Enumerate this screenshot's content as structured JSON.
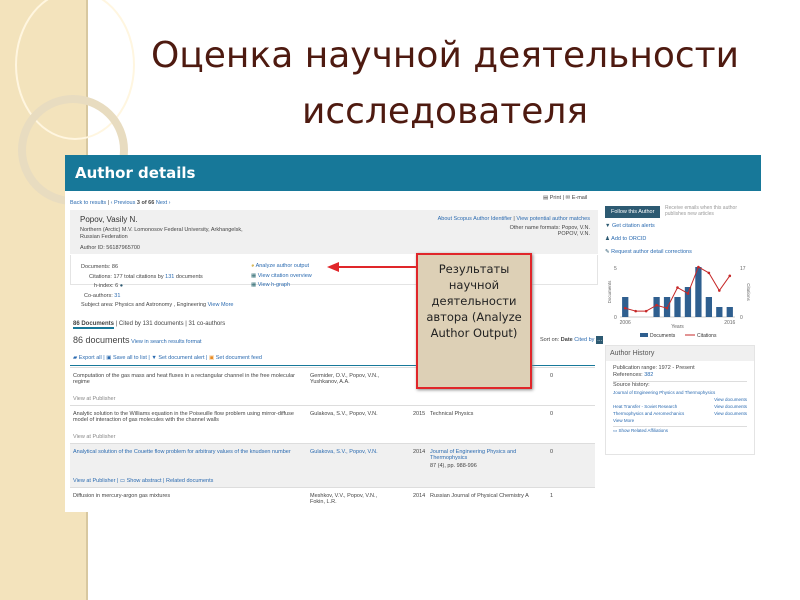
{
  "slide": {
    "title": "Оценка научной деятельности исследователя",
    "callout": "Результаты научной деятельности автора (Analyze Author Output)"
  },
  "header": {
    "title": "Author details"
  },
  "nav": {
    "back": "Back to results",
    "previous": "‹ Previous",
    "position": "3 of 66",
    "next": "Next ›",
    "print": "Print",
    "email": "E-mail"
  },
  "author": {
    "name": "Popov, Vasily N.",
    "affiliation": "Northern (Arctic) M.V. Lomonosov Federal University, Arkhangelsk, Russian Federation",
    "author_id": "Author ID: 56187965700",
    "about_link": "About Scopus Author Identifier",
    "matches_link": "View potential author matches",
    "other_names_label": "Other name formats:",
    "other_names": [
      "Popov, V.N.",
      "POPOV, V.N."
    ]
  },
  "metrics": {
    "documents_label": "Documents:",
    "documents": "86",
    "citations_label": "Citations:",
    "citations_text": "177 total citations by",
    "citing_docs": "131",
    "citations_suffix": "documents",
    "hindex_label": "h-index:",
    "hindex": "6",
    "coauthors_label": "Co-authors:",
    "coauthors": "31",
    "subject_label": "Subject area:",
    "subjects": "Physics and Astronomy , Engineering",
    "view_more": "View More"
  },
  "tools": {
    "analyze": "Analyze author output",
    "citation_overview": "View citation overview",
    "hgraph": "View h-graph"
  },
  "tabs": {
    "documents": "86 Documents",
    "cited_by": "Cited by 131 documents",
    "coauthors": "31 co-authors"
  },
  "list": {
    "count": "86 documents",
    "search_format": "View in search results format",
    "sort_label": "Sort on:",
    "sort_date": "Date",
    "sort_cited": "Cited by",
    "export": "Export all",
    "save": "Save all to list",
    "alert": "Set document alert",
    "feed": "Set document feed"
  },
  "documents": [
    {
      "title": "Computation of the gas mass and heat fluxes in a rectangular channel in the free molecular regime",
      "authors": "Germider, O.V., Popov, V.N., Yushkanov, A.A.",
      "year": "",
      "source": "",
      "cited": "0",
      "actions": [
        "View at Publisher"
      ]
    },
    {
      "title": "Analytic solution to the Williams equation in the Poiseuille flow problem using mirror-diffuse model of interaction of gas molecules with the channel walls",
      "authors": "Gulakova, S.V., Popov, V.N.",
      "year": "2015",
      "source": "Technical Physics",
      "cited": "0",
      "actions": [
        "View at Publisher"
      ]
    },
    {
      "title": "Analytical solution of the Couette flow problem for arbitrary values of the knudsen number",
      "authors": "Gulakova, S.V., Popov, V.N.",
      "year": "2014",
      "source": "Journal of Engineering Physics and Thermophysics",
      "source_detail": "87 (4), pp. 988-996",
      "cited": "0",
      "actions": [
        "View at Publisher",
        "Show abstract",
        "Related documents"
      ]
    },
    {
      "title": "Diffusion in mercury-argon gas mixtures",
      "authors": "Meshkov, V.V., Popov, V.N., Fokin, L.R.",
      "year": "2014",
      "source": "Russian Journal of Physical Chemistry A",
      "cited": "1",
      "actions": []
    }
  ],
  "sidebar": {
    "follow": "Follow this Author",
    "follow_note": "Receive emails when this author publishes new articles",
    "alerts": "Get citation alerts",
    "orcid": "Add to ORCID",
    "corrections": "Request author detail corrections"
  },
  "history": {
    "title": "Author History",
    "range": "Publication range: 1972 - Present",
    "references_label": "References:",
    "references": "382",
    "source_label": "Source history:",
    "sources": [
      {
        "name": "Journal of Engineering Physics and Thermophysics",
        "link": "View documents"
      },
      {
        "name": "Heat Transfer - Soviet Research",
        "link": "View documents"
      },
      {
        "name": "Thermophysics and Aeromechanics",
        "link": "View documents"
      }
    ],
    "view_more": "View More",
    "affiliations": "Show Related Affiliations"
  },
  "chart_data": {
    "type": "bar",
    "title": "",
    "xlabel": "Years",
    "ylabel": "Documents",
    "y2label": "Citations",
    "x": [
      2006,
      2007,
      2008,
      2009,
      2010,
      2011,
      2012,
      2013,
      2014,
      2015,
      2016
    ],
    "xticks": [
      "2006",
      "2016"
    ],
    "ylim": [
      0,
      5
    ],
    "y2lim": [
      0,
      17
    ],
    "yticks": [
      "0",
      "5"
    ],
    "y2ticks": [
      "0",
      "17"
    ],
    "series": [
      {
        "name": "Documents",
        "type": "bar",
        "color": "#2f5f8f",
        "values": [
          2,
          0,
          0,
          2,
          2,
          2,
          3,
          5,
          2,
          1,
          1
        ]
      },
      {
        "name": "Citations",
        "type": "line",
        "color": "#c62828",
        "values": [
          3,
          2,
          2,
          4,
          3,
          10,
          8,
          17,
          15,
          9,
          14
        ]
      }
    ],
    "legend": "bottom"
  }
}
